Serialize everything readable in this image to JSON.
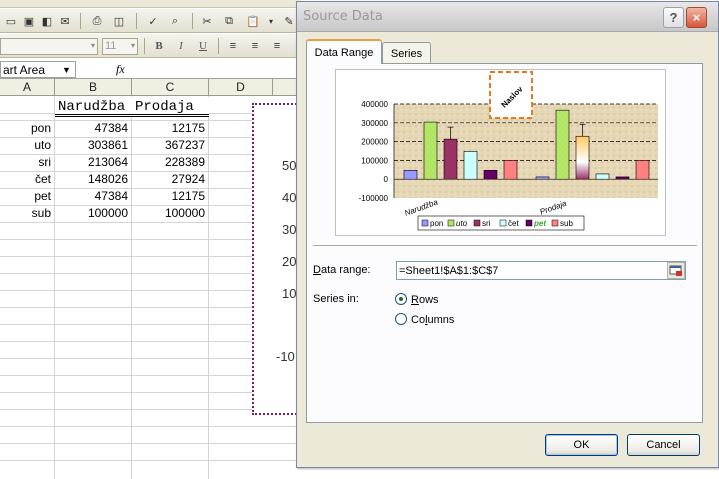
{
  "excel": {
    "name_box": "art Area",
    "fx_label": "fx",
    "font_size_value": "11",
    "columns": [
      "A",
      "B",
      "C",
      "D"
    ],
    "headers": {
      "b1": "Narudžba",
      "c1": "Prodaja"
    },
    "rows": [
      {
        "day": "pon",
        "b": "47384",
        "c": "12175"
      },
      {
        "day": "uto",
        "b": "303861",
        "c": "367237"
      },
      {
        "day": "sri",
        "b": "213064",
        "c": "228389"
      },
      {
        "day": "čet",
        "b": "148026",
        "c": "27924"
      },
      {
        "day": "pet",
        "b": "47384",
        "c": "12175"
      },
      {
        "day": "sub",
        "b": "100000",
        "c": "100000"
      }
    ],
    "chart_axis_labels": [
      "50",
      "40",
      "30",
      "20",
      "10",
      "-10"
    ]
  },
  "dialog": {
    "title": "Source Data",
    "help_label": "?",
    "close_label": "×",
    "tabs": [
      "Data Range",
      "Series"
    ],
    "data_range_label": "Data range:",
    "data_range_value": "=Sheet1!$A$1:$C$7",
    "series_in_label": "Series in:",
    "radio_rows": "Rows",
    "radio_columns": "Columns",
    "ok_label": "OK",
    "cancel_label": "Cancel"
  },
  "chart_data": {
    "type": "bar",
    "categories": [
      "Narudžba",
      "Prodaja"
    ],
    "series": [
      {
        "name": "pon",
        "values": [
          47384,
          12175
        ],
        "color": "#9999ff"
      },
      {
        "name": "uto",
        "values": [
          303861,
          367237
        ],
        "color": "#99ff33"
      },
      {
        "name": "sri",
        "values": [
          213064,
          228389
        ],
        "color": "#993366"
      },
      {
        "name": "čet",
        "values": [
          148026,
          27924
        ],
        "color": "#ccffff"
      },
      {
        "name": "pet",
        "values": [
          47384,
          12175
        ],
        "color": "#660066"
      },
      {
        "name": "sub",
        "values": [
          100000,
          100000
        ],
        "color": "#ff8080"
      }
    ],
    "yticks": [
      "400000",
      "300000",
      "200000",
      "100000",
      "0",
      "-100000"
    ],
    "ylim": [
      -100000,
      400000
    ],
    "title": "Naslov",
    "legend": "bottom"
  }
}
